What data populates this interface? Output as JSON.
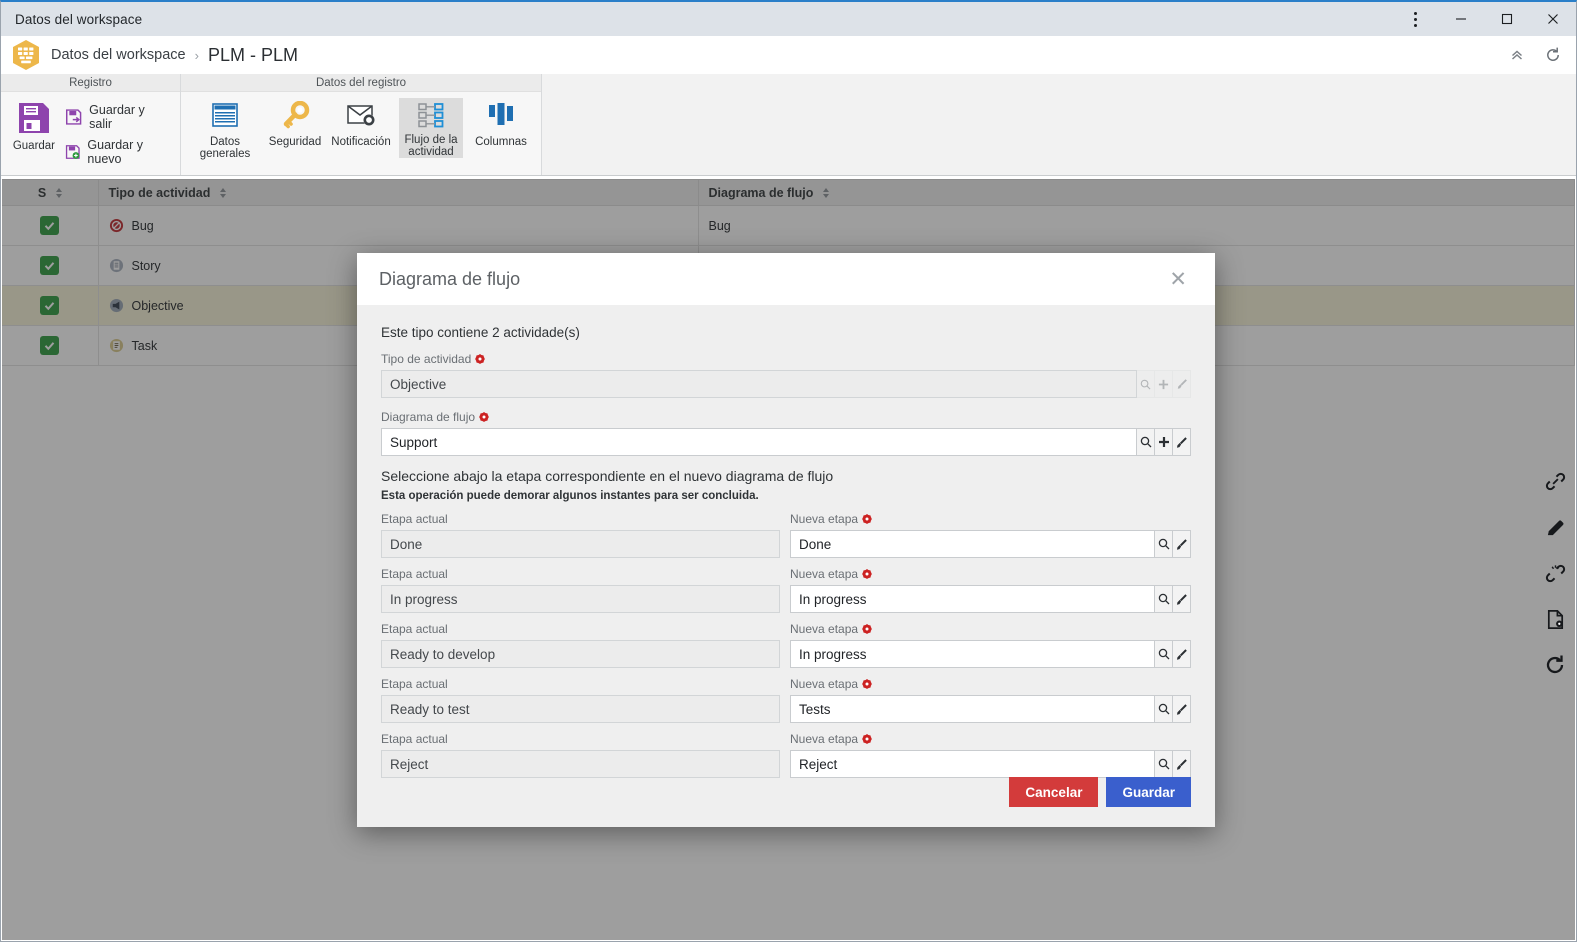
{
  "window": {
    "tab_title": "Datos del workspace",
    "controls": {
      "menu": "more-options",
      "minimize": "—",
      "maximize": "☐",
      "close": "✕"
    }
  },
  "breadcrumb": {
    "root": "Datos del workspace",
    "separator": "›",
    "current": "PLM - PLM",
    "collapse_label": "collapse-ribbon",
    "refresh_label": "refresh"
  },
  "ribbon": {
    "groups": [
      {
        "title": "Registro",
        "big": [
          {
            "label": "Guardar",
            "icon": "save-icon"
          }
        ],
        "small": [
          {
            "label": "Guardar y salir",
            "icon": "save-and-exit-icon"
          },
          {
            "label": "Guardar y nuevo",
            "icon": "save-and-new-icon"
          }
        ]
      },
      {
        "title": "Datos del registro",
        "big": [
          {
            "label": "Datos generales",
            "icon": "general-data-icon"
          },
          {
            "label": "Seguridad",
            "icon": "key-icon"
          },
          {
            "label": "Notificación",
            "icon": "notification-icon"
          },
          {
            "label": "Flujo de la actividad",
            "icon": "activity-flow-icon"
          },
          {
            "label": "Columnas",
            "icon": "columns-icon"
          }
        ],
        "small": []
      }
    ]
  },
  "grid": {
    "columns": [
      {
        "label": "S",
        "name": "col-select"
      },
      {
        "label": "Tipo de actividad",
        "name": "col-activity-type"
      },
      {
        "label": "Diagrama de flujo",
        "name": "col-flow-diagram"
      }
    ],
    "rows": [
      {
        "checked": true,
        "type": "Bug",
        "type_icon": "bug-icon",
        "flow": "Bug",
        "selected": false
      },
      {
        "checked": true,
        "type": "Story",
        "type_icon": "story-icon",
        "flow": "",
        "selected": false
      },
      {
        "checked": true,
        "type": "Objective",
        "type_icon": "objective-icon",
        "flow": "",
        "selected": true
      },
      {
        "checked": true,
        "type": "Task",
        "type_icon": "task-icon",
        "flow": "",
        "selected": false
      }
    ]
  },
  "rail": {
    "items": [
      {
        "name": "link-icon"
      },
      {
        "name": "pencil-icon"
      },
      {
        "name": "unlink-icon"
      },
      {
        "name": "document-settings-icon"
      },
      {
        "name": "refresh-icon"
      }
    ]
  },
  "dialog": {
    "title": "Diagrama de flujo",
    "close_label": "✕",
    "intro": "Este tipo contiene 2 actividade(s)",
    "fields": [
      {
        "label": "Tipo de actividad",
        "required": true,
        "value": "Objective",
        "readonly": true,
        "buttons": [
          "search-icon",
          "add-icon",
          "brush-icon"
        ]
      },
      {
        "label": "Diagrama de flujo",
        "required": true,
        "value": "Support",
        "readonly": false,
        "buttons": [
          "search-icon",
          "add-icon",
          "brush-icon"
        ]
      }
    ],
    "section_title": "Seleccione abajo la etapa correspondiente en el nuevo diagrama de flujo",
    "section_note": "Esta operación puede demorar algunos instantes para ser concluida.",
    "current_label": "Etapa actual",
    "new_label": "Nueva etapa",
    "stage_buttons": [
      "search-icon",
      "brush-icon"
    ],
    "stages": [
      {
        "current": "Done",
        "new": "Done"
      },
      {
        "current": "In progress",
        "new": "In progress"
      },
      {
        "current": "Ready to develop",
        "new": "In progress"
      },
      {
        "current": "Ready to test",
        "new": "Tests"
      },
      {
        "current": "Reject",
        "new": "Reject"
      }
    ],
    "buttons": {
      "cancel": "Cancelar",
      "save": "Guardar"
    }
  },
  "colors": {
    "accent_blue": "#2a7fc9",
    "save_purple": "#8e44ad",
    "cancel_red": "#d33b3b",
    "save_blue": "#3a5fcd",
    "check_green": "#2e9b3f",
    "required_red": "#cc2222",
    "row_selected": "#f6f3d8"
  }
}
